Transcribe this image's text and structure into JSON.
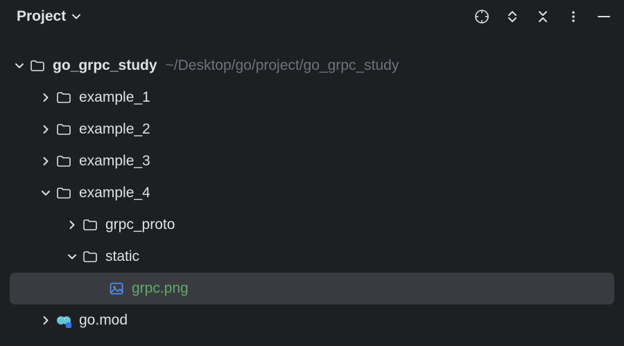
{
  "toolbar": {
    "title": "Project"
  },
  "root": {
    "name": "go_grpc_study",
    "path": "~/Desktop/go/project/go_grpc_study"
  },
  "tree": {
    "example_1": "example_1",
    "example_2": "example_2",
    "example_3": "example_3",
    "example_4": "example_4",
    "grpc_proto": "grpc_proto",
    "static": "static",
    "grpc_png": "grpc.png",
    "go_mod": "go.mod"
  }
}
